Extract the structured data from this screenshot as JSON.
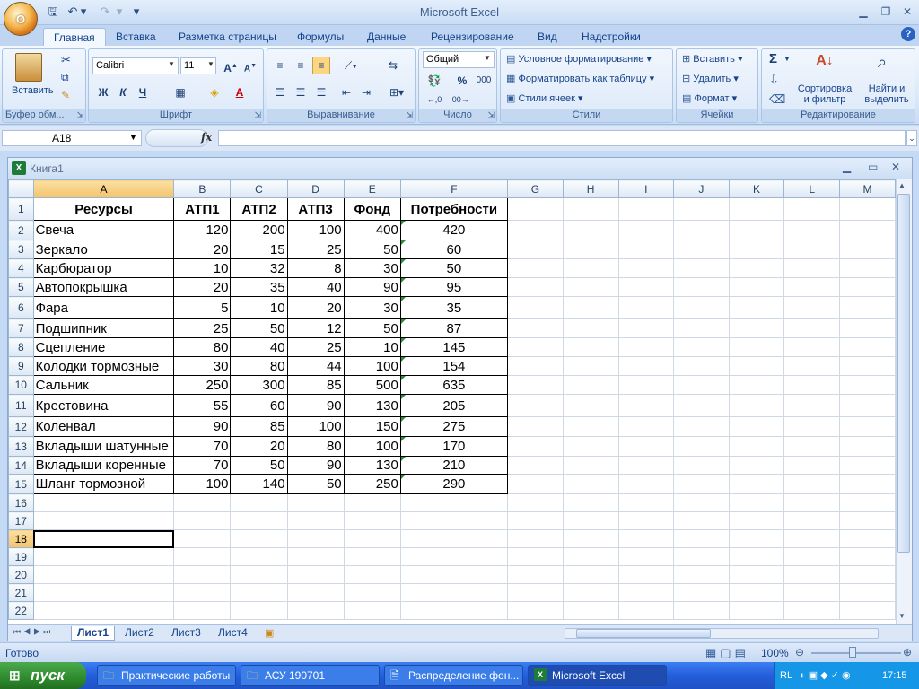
{
  "app": {
    "title": "Microsoft Excel",
    "office_button": "O"
  },
  "qat": {
    "save_icon": "save-icon",
    "undo_icon": "undo-icon",
    "redo_icon": "redo-icon"
  },
  "tabs": [
    "Главная",
    "Вставка",
    "Разметка страницы",
    "Формулы",
    "Данные",
    "Рецензирование",
    "Вид",
    "Надстройки"
  ],
  "ribbon": {
    "clipboard": {
      "label": "Буфер обм...",
      "paste": "Вставить"
    },
    "font": {
      "label": "Шрифт",
      "name": "Calibri",
      "size": "11",
      "bold": "Ж",
      "italic": "К",
      "underline": "Ч"
    },
    "alignment": {
      "label": "Выравнивание"
    },
    "number": {
      "label": "Число",
      "format": "Общий",
      "percent": "%",
      "thousands": "000"
    },
    "styles": {
      "label": "Стили",
      "cond": "Условное форматирование",
      "table": "Форматировать как таблицу",
      "cell": "Стили ячеек"
    },
    "cells": {
      "label": "Ячейки",
      "insert": "Вставить",
      "delete": "Удалить",
      "format": "Формат"
    },
    "editing": {
      "label": "Редактирование",
      "sort": "Сортировка",
      "sort2": "и фильтр",
      "find": "Найти и",
      "find2": "выделить",
      "sigma": "Σ"
    }
  },
  "formula_bar": {
    "name_box": "A18",
    "fx": "fx",
    "value": ""
  },
  "workbook": {
    "title": "Книга1"
  },
  "sheet": {
    "columns": [
      "A",
      "B",
      "C",
      "D",
      "E",
      "F",
      "G",
      "H",
      "I",
      "J",
      "K",
      "L",
      "M"
    ],
    "header_row": [
      "Ресурсы",
      "АТП1",
      "АТП2",
      "АТП3",
      "Фонд",
      "Потребности"
    ],
    "rows": [
      [
        "Свеча",
        "120",
        "200",
        "100",
        "400",
        "420"
      ],
      [
        "Зеркало",
        "20",
        "15",
        "25",
        "50",
        "60"
      ],
      [
        "Карбюратор",
        "10",
        "32",
        "8",
        "30",
        "50"
      ],
      [
        "Автопокрышка",
        "20",
        "35",
        "40",
        "90",
        "95"
      ],
      [
        "Фара",
        "5",
        "10",
        "20",
        "30",
        "35"
      ],
      [
        "Подшипник",
        "25",
        "50",
        "12",
        "50",
        "87"
      ],
      [
        "Сцепление",
        "80",
        "40",
        "25",
        "10",
        "145"
      ],
      [
        "Колодки тормозные",
        "30",
        "80",
        "44",
        "100",
        "154"
      ],
      [
        "Сальник",
        "250",
        "300",
        "85",
        "500",
        "635"
      ],
      [
        "Крестовина",
        "55",
        "60",
        "90",
        "130",
        "205"
      ],
      [
        "Коленвал",
        "90",
        "85",
        "100",
        "150",
        "275"
      ],
      [
        "Вкладыши шатунные",
        "70",
        "20",
        "80",
        "100",
        "170"
      ],
      [
        "Вкладыши коренные",
        "70",
        "50",
        "90",
        "130",
        "210"
      ],
      [
        "Шланг тормозной",
        "100",
        "140",
        "50",
        "250",
        "290"
      ]
    ],
    "row_numbers": [
      "1",
      "2",
      "3",
      "4",
      "5",
      "6",
      "7",
      "8",
      "9",
      "10",
      "11",
      "12",
      "13",
      "14",
      "15",
      "16",
      "17",
      "18",
      "19",
      "20",
      "21",
      "22"
    ],
    "selected_cell": "A18",
    "tabs": [
      "Лист1",
      "Лист2",
      "Лист3",
      "Лист4"
    ]
  },
  "status": {
    "ready": "Готово",
    "zoom": "100%"
  },
  "taskbar": {
    "start": "пуск",
    "items": [
      "Практические работы",
      "АСУ 190701",
      "Распределение фон...",
      "Microsoft Excel"
    ],
    "lang": "RL",
    "time": "17:15"
  }
}
